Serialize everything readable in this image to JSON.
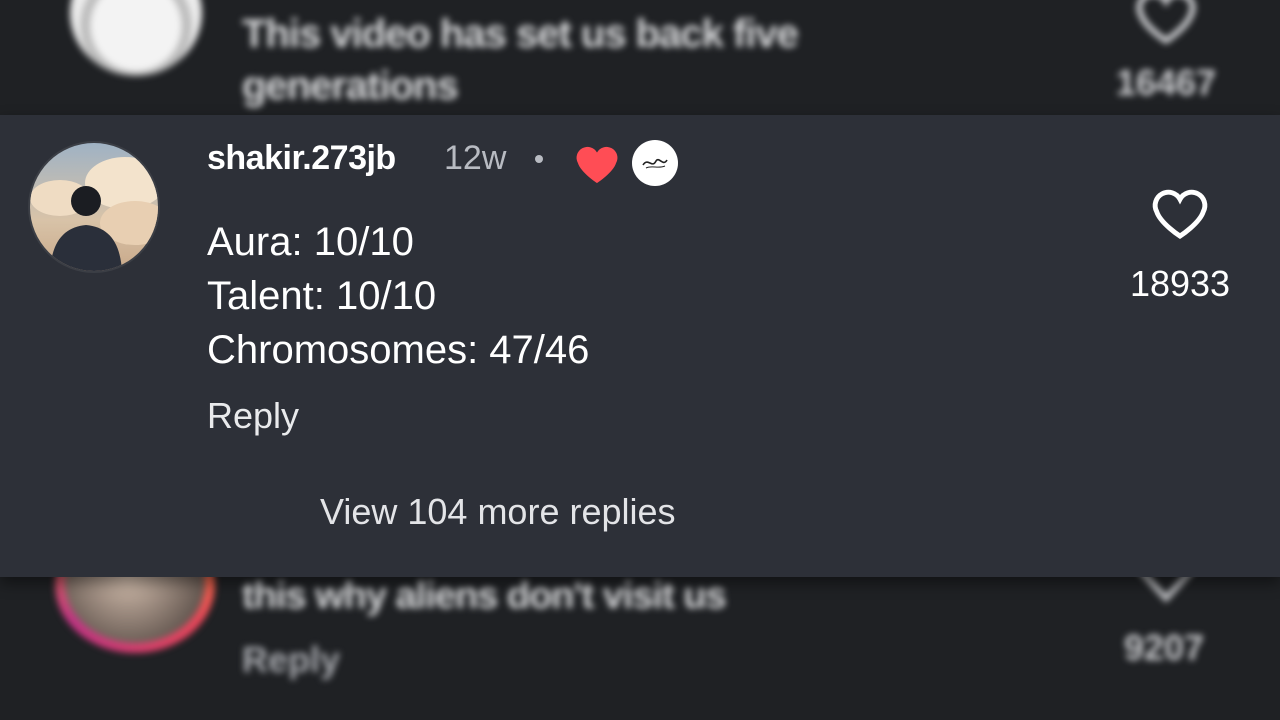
{
  "colors": {
    "background": "#1f2124",
    "highlight_background": "#2d3038",
    "creator_heart": "#ff4d55",
    "primary_text": "#ffffff",
    "secondary_text": "#b8bbc2"
  },
  "top_comment": {
    "text": "This video has set us back five generations",
    "like_count": "16467",
    "icon": "heart-outline-icon"
  },
  "highlighted_comment": {
    "username": "shakir.273jb",
    "time_ago": "12w",
    "creator_liked_icon": "heart-filled-icon",
    "creator_badge_icon": "creator-avatar-icon",
    "lines": [
      "Aura: 10/10",
      "Talent: 10/10",
      "Chromosomes: 47/46"
    ],
    "reply_label": "Reply",
    "view_replies_label": "View 104 more replies",
    "like_count": "18933",
    "like_icon": "heart-outline-icon"
  },
  "bottom_comment": {
    "text": "this why aliens don't visit us",
    "reply_label": "Reply",
    "like_count": "9207",
    "icon": "heart-outline-icon"
  }
}
